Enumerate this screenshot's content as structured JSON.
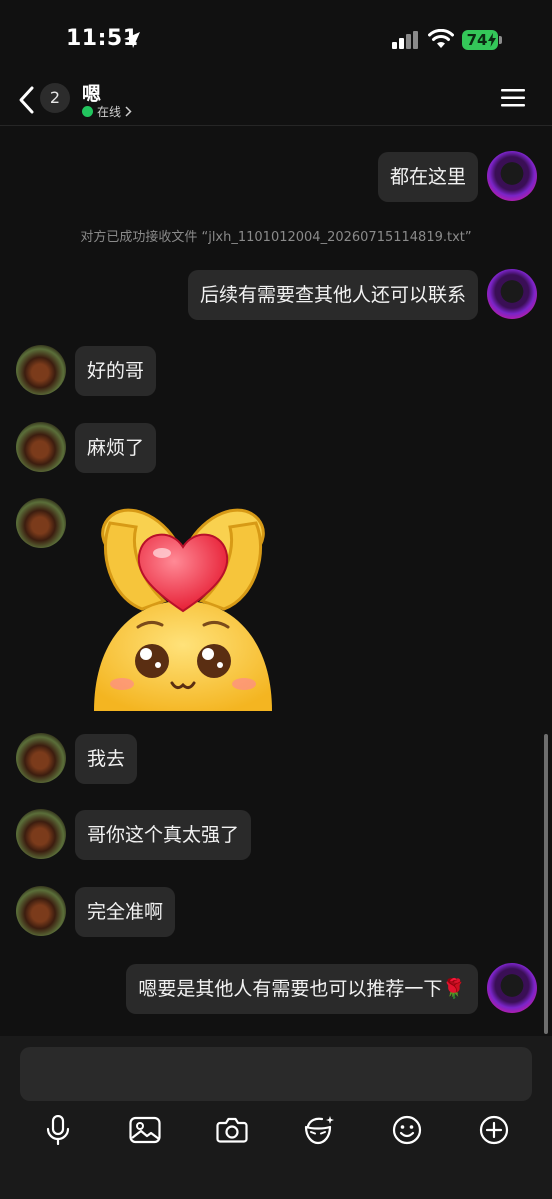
{
  "status_bar": {
    "time": "11:51",
    "battery": "74"
  },
  "header": {
    "unread_count": "2",
    "contact_name": "嗯",
    "presence": "在线"
  },
  "messages": [
    {
      "from": "me",
      "text": "都在这里"
    },
    {
      "from": "system",
      "text": "对方已成功接收文件 “jlxh_1101012004_20260715114819.txt”"
    },
    {
      "from": "me",
      "text": "后续有需要查其他人还可以联系"
    },
    {
      "from": "peer",
      "text": "好的哥"
    },
    {
      "from": "peer",
      "text": "麻烦了"
    },
    {
      "from": "peer",
      "sticker": "heart-hands-sticker"
    },
    {
      "from": "peer",
      "text": "我去"
    },
    {
      "from": "peer",
      "text": "哥你这个真太强了"
    },
    {
      "from": "peer",
      "text": "完全准啊"
    },
    {
      "from": "me",
      "text": "嗯要是其他人有需要也可以推荐一下",
      "emoji": "🌹"
    }
  ],
  "input": {
    "value": ""
  },
  "toolbar": [
    "microphone-icon",
    "image-icon",
    "camera-icon",
    "face-mask-icon",
    "emoji-icon",
    "plus-icon"
  ],
  "colors": {
    "background": "#111111",
    "bubble": "#2a2a2a",
    "online": "#22c55e",
    "battery": "#34c759"
  }
}
